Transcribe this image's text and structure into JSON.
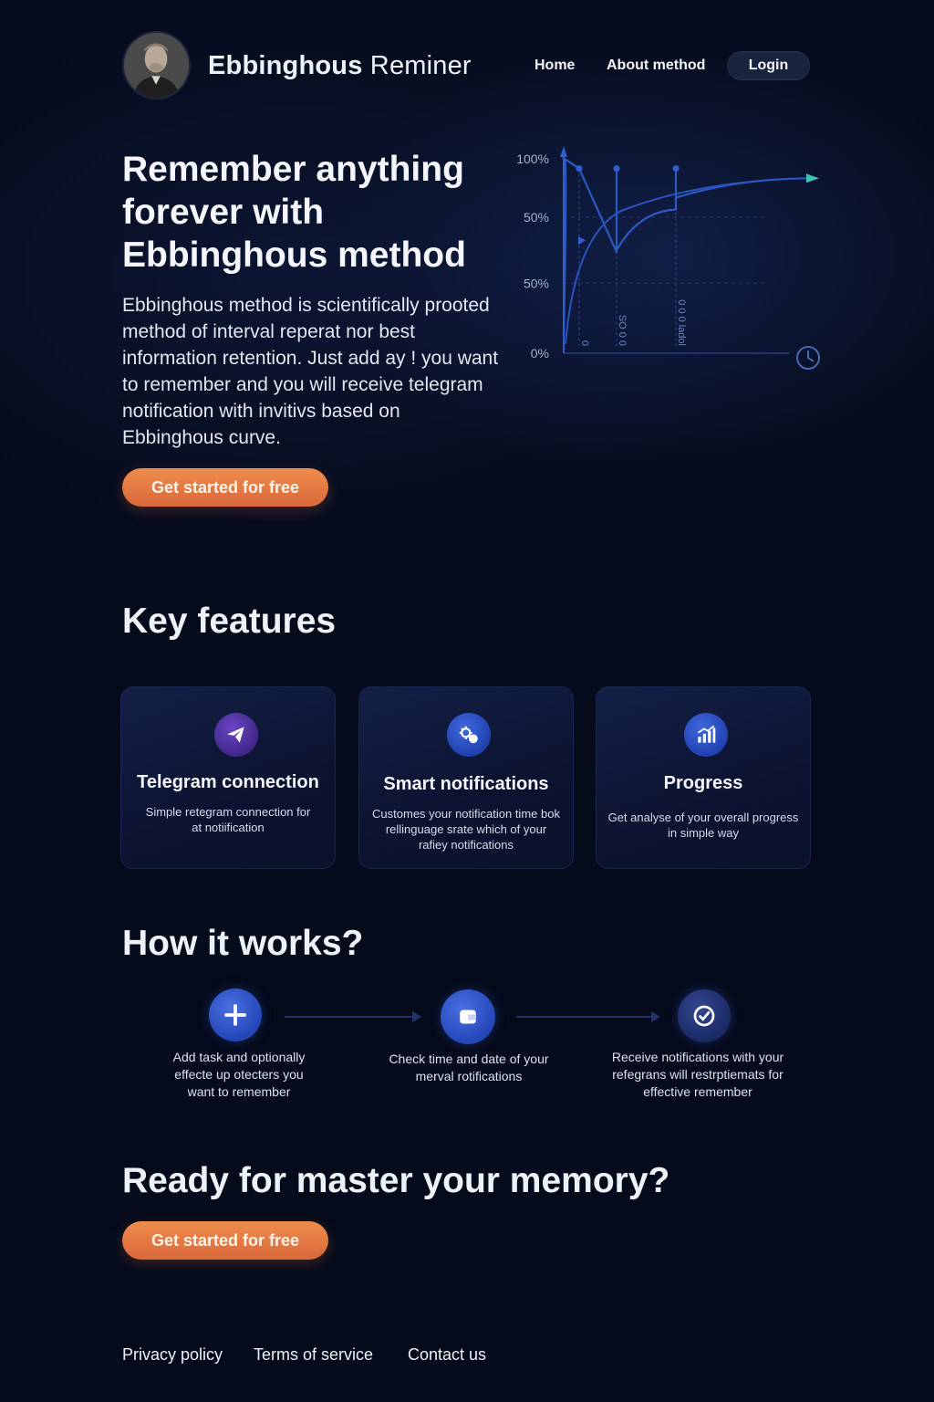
{
  "header": {
    "brand_bold": "Ebbinghous",
    "brand_light": "Reminer",
    "nav": {
      "home": "Home",
      "about": "About method",
      "login": "Login"
    }
  },
  "hero": {
    "title": "Remember anything forever with Ebbinghous method",
    "description": "Ebbinghous method is scientifically prooted method of interval reperat nor best information retention. Just add ay ! you want to remember and you will receive telegram notification with invitivs based on Ebbinghous curve.",
    "cta": "Get started for free"
  },
  "chart_data": {
    "type": "line",
    "title": "",
    "xlabel": "",
    "ylabel": "",
    "ytick_labels": [
      "100%",
      "50%",
      "50%",
      "0%"
    ],
    "vertical_labels": [
      "0",
      "SO 0 0",
      "0 0 0 ladol"
    ],
    "ylim": [
      0,
      100
    ],
    "series": [
      {
        "values": [
          100,
          95,
          52,
          95,
          73,
          95,
          80,
          90
        ]
      }
    ],
    "grid": true,
    "colors": {
      "curve": "#2f5fd0",
      "arrow": "#3dc1b5",
      "clock": "#4b68b0"
    }
  },
  "features": {
    "title": "Key features",
    "cards": [
      {
        "icon": "paper-plane-icon",
        "title": "Telegram connection",
        "desc": "Simple retegram  connection for at notiification"
      },
      {
        "icon": "bell-gear-icon",
        "title": "Smart notifications",
        "desc": "Customes your notification time bok rellinguage srate which of your rafiey notifications"
      },
      {
        "icon": "bar-chart-icon",
        "title": "Progress",
        "desc": "Get analyse of your overall progress in simple way"
      }
    ]
  },
  "how": {
    "title": "How it works?",
    "steps": [
      {
        "icon": "plus-icon",
        "text": "Add task and optionally effecte up otecters you want to remember"
      },
      {
        "icon": "folder-icon",
        "text": "Check time and date of your merval rotifications"
      },
      {
        "icon": "check-circle-icon",
        "text": "Receive notifications with your refegrans will restrptiemats for effective remember"
      }
    ]
  },
  "ready": {
    "title": "Ready for master your memory?",
    "cta": "Get started for free"
  },
  "footer": {
    "privacy": "Privacy policy",
    "terms": "Terms of service",
    "contact": "Contact us"
  },
  "colors": {
    "background": "#060b1b",
    "accent_orange": "#e57a42",
    "card_bg": "#0e1736",
    "icon_blue": "#2447b8",
    "icon_purple": "#4a2c8f"
  }
}
